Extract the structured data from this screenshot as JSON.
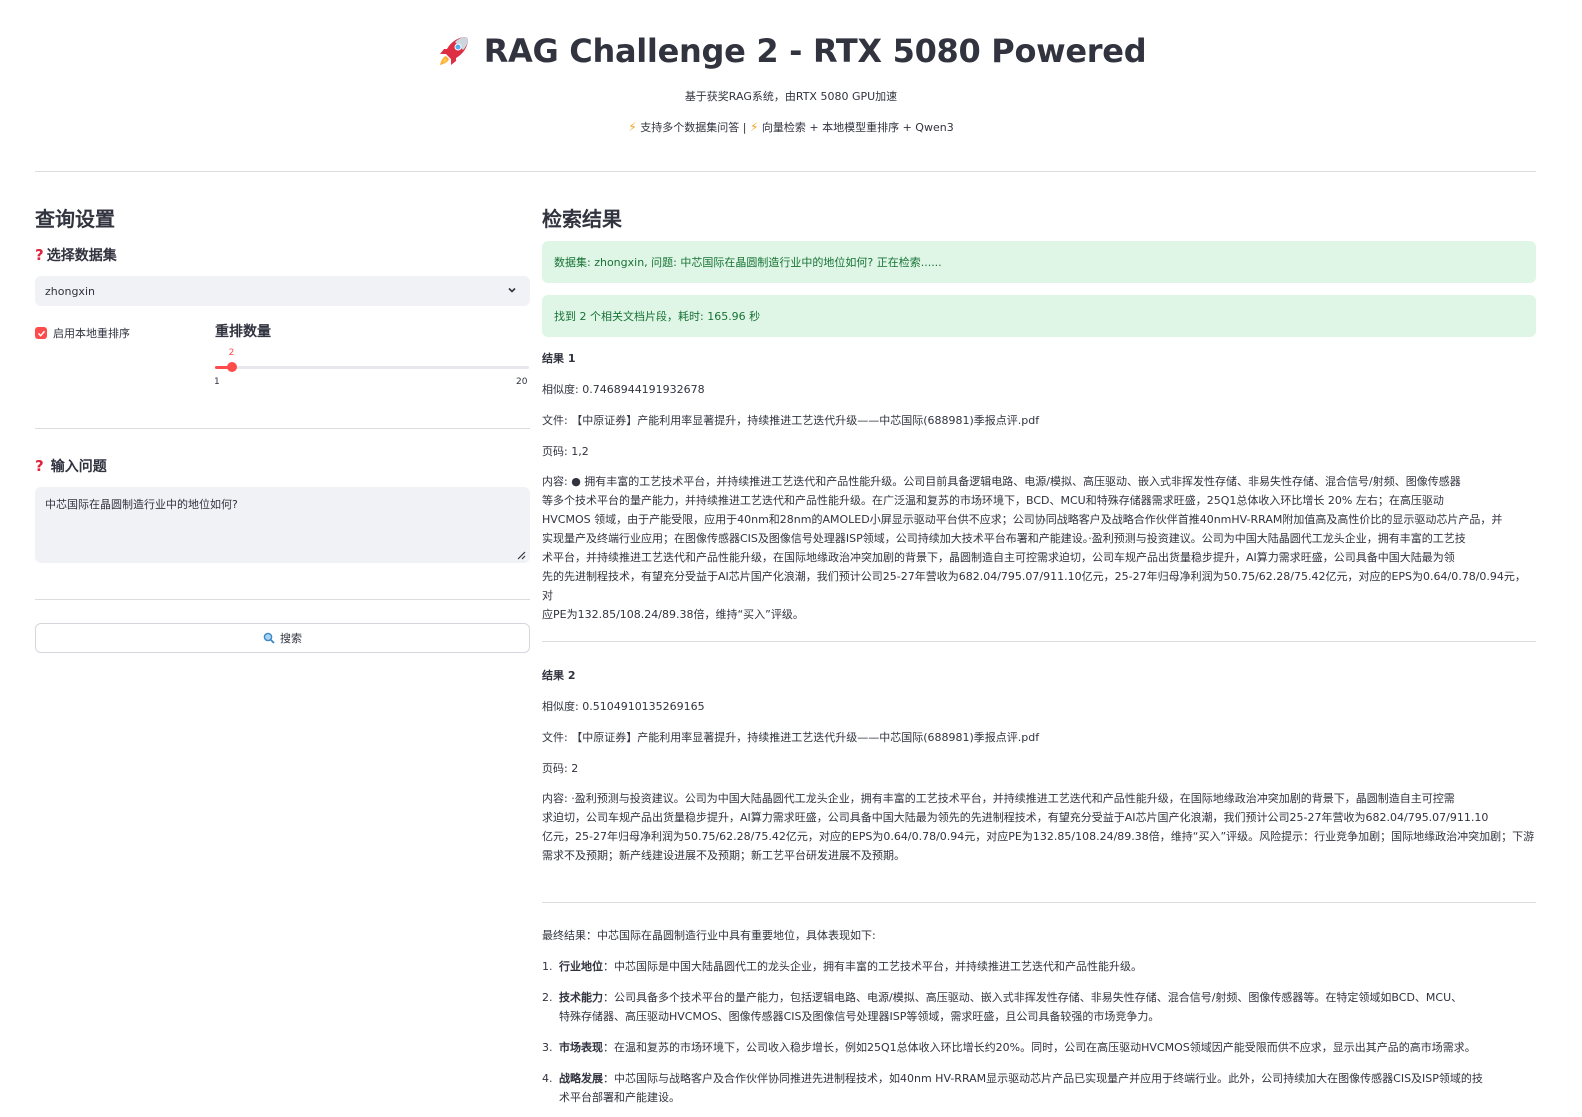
{
  "header": {
    "title": "RAG Challenge 2 - RTX 5080 Powered",
    "subtitle": "基于获奖RAG系统，由RTX 5080 GPU加速",
    "feature_1": "支持多个数据集问答 |",
    "feature_2": "向量检索 + 本地模型重排序 + Qwen3",
    "icon": "rocket-icon"
  },
  "left": {
    "heading": "查询设置",
    "dataset_label": "选择数据集",
    "dataset_value": "zhongxin",
    "rerank_checkbox_label": "启用本地重排序",
    "rerank_checked": true,
    "rerank_count_label": "重排数量",
    "rerank_count_value": "2",
    "rerank_count_min": "1",
    "rerank_count_max": "20",
    "rerank_fraction": 0.053,
    "question_label": "输入问题",
    "question_value": "中芯国际在晶圆制造行业中的地位如何?",
    "search_button": "搜索"
  },
  "right": {
    "heading": "检索结果",
    "status_1": "数据集: zhongxin, 问题: 中芯国际在晶圆制造行业中的地位如何?  正在检索......",
    "status_2": "找到 2 个相关文档片段，耗时: 165.96 秒",
    "results": [
      {
        "title": "结果 1",
        "similarity": "相似度: 0.7468944191932678",
        "file": "文件: 【中原证券】产能利用率显著提升，持续推进工艺迭代升级——中芯国际(688981)季报点评.pdf",
        "pages": "页码: 1,2",
        "content_lines": [
          "内容: ● 拥有丰富的工艺技术平台，并持续推进工艺迭代和产品性能升级。公司目前具备逻辑电路、电源/模拟、高压驱动、嵌入式非挥发性存储、非易失性存储、混合信号/射频、图像传感器",
          "等多个技术平台的量产能力，并持续推进工艺迭代和产品性能升级。在广泛温和复苏的市场环境下，BCD、MCU和特殊存储器需求旺盛，25Q1总体收入环比增长 20% 左右；在高压驱动",
          "HVCMOS 领域，由于产能受限，应用于40nm和28nm的AMOLED小屏显示驱动平台供不应求；公司协同战略客户及战略合作伙伴首推40nmHV-RRAM附加值高及高性价比的显示驱动芯片产品，并",
          "实现量产及终端行业应用；在图像传感器CIS及图像信号处理器ISP领域，公司持续加大技术平台布署和产能建设。·盈利预测与投资建议。公司为中国大陆晶圆代工龙头企业，拥有丰富的工艺技",
          "术平台，并持续推进工艺迭代和产品性能升级，在国际地缘政治冲突加剧的背景下，晶圆制造自主可控需求迫切，公司车规产品出货量稳步提升，AI算力需求旺盛，公司具备中国大陆最为领",
          "先的先进制程技术，有望充分受益于AI芯片国产化浪潮，我们预计公司25-27年营收为682.04/795.07/911.10亿元，25-27年归母净利润为50.75/62.28/75.42亿元，对应的EPS为0.64/0.78/0.94元，对",
          "应PE为132.85/108.24/89.38倍，维持“买入”评级。"
        ]
      },
      {
        "title": "结果 2",
        "similarity": "相似度: 0.5104910135269165",
        "file": "文件: 【中原证券】产能利用率显著提升，持续推进工艺迭代升级——中芯国际(688981)季报点评.pdf",
        "pages": "页码: 2",
        "content_lines": [
          "内容: ·盈利预测与投资建议。公司为中国大陆晶圆代工龙头企业，拥有丰富的工艺技术平台，并持续推进工艺迭代和产品性能升级，在国际地缘政治冲突加剧的背景下，晶圆制造自主可控需",
          "求迫切，公司车规产品出货量稳步提升，AI算力需求旺盛，公司具备中国大陆最为领先的先进制程技术，有望充分受益于AI芯片国产化浪潮，我们预计公司25-27年营收为682.04/795.07/911.10",
          "亿元，25-27年归母净利润为50.75/62.28/75.42亿元，对应的EPS为0.64/0.78/0.94元，对应PE为132.85/108.24/89.38倍，维持“买入”评级。风险提示：行业竞争加剧；国际地缘政治冲突加剧；下游",
          "需求不及预期；新产线建设进展不及预期；新工艺平台研发进展不及预期。"
        ]
      }
    ],
    "final_intro": "最终结果：中芯国际在晶圆制造行业中具有重要地位，具体表现如下:",
    "final_items": [
      {
        "num": "1.",
        "label": "行业地位",
        "lines": [
          "：中芯国际是中国大陆晶圆代工的龙头企业，拥有丰富的工艺技术平台，并持续推进工艺迭代和产品性能升级。"
        ]
      },
      {
        "num": "2.",
        "label": "技术能力",
        "lines": [
          "：公司具备多个技术平台的量产能力，包括逻辑电路、电源/模拟、高压驱动、嵌入式非挥发性存储、非易失性存储、混合信号/射频、图像传感器等。在特定领域如BCD、MCU、",
          "特殊存储器、高压驱动HVCMOS、图像传感器CIS及图像信号处理器ISP等领域，需求旺盛，且公司具备较强的市场竞争力。"
        ]
      },
      {
        "num": "3.",
        "label": "市场表现",
        "lines": [
          "：在温和复苏的市场环境下，公司收入稳步增长，例如25Q1总体收入环比增长约20%。同时，公司在高压驱动HVCMOS领域因产能受限而供不应求，显示出其产品的高市场需求。"
        ]
      },
      {
        "num": "4.",
        "label": "战略发展",
        "lines": [
          "：中芯国际与战略客户及合作伙伴协同推进先进制程技术，如40nm HV-RRAM显示驱动芯片产品已实现量产并应用于终端行业。此外，公司持续加大在图像传感器CIS及ISP领域的技",
          "术平台部署和产能建设。"
        ]
      }
    ]
  },
  "colors": {
    "accent": "#ff4b4b",
    "success_bg": "#dff6e7",
    "success_text": "#177233",
    "input_bg": "#f0f2f6"
  }
}
